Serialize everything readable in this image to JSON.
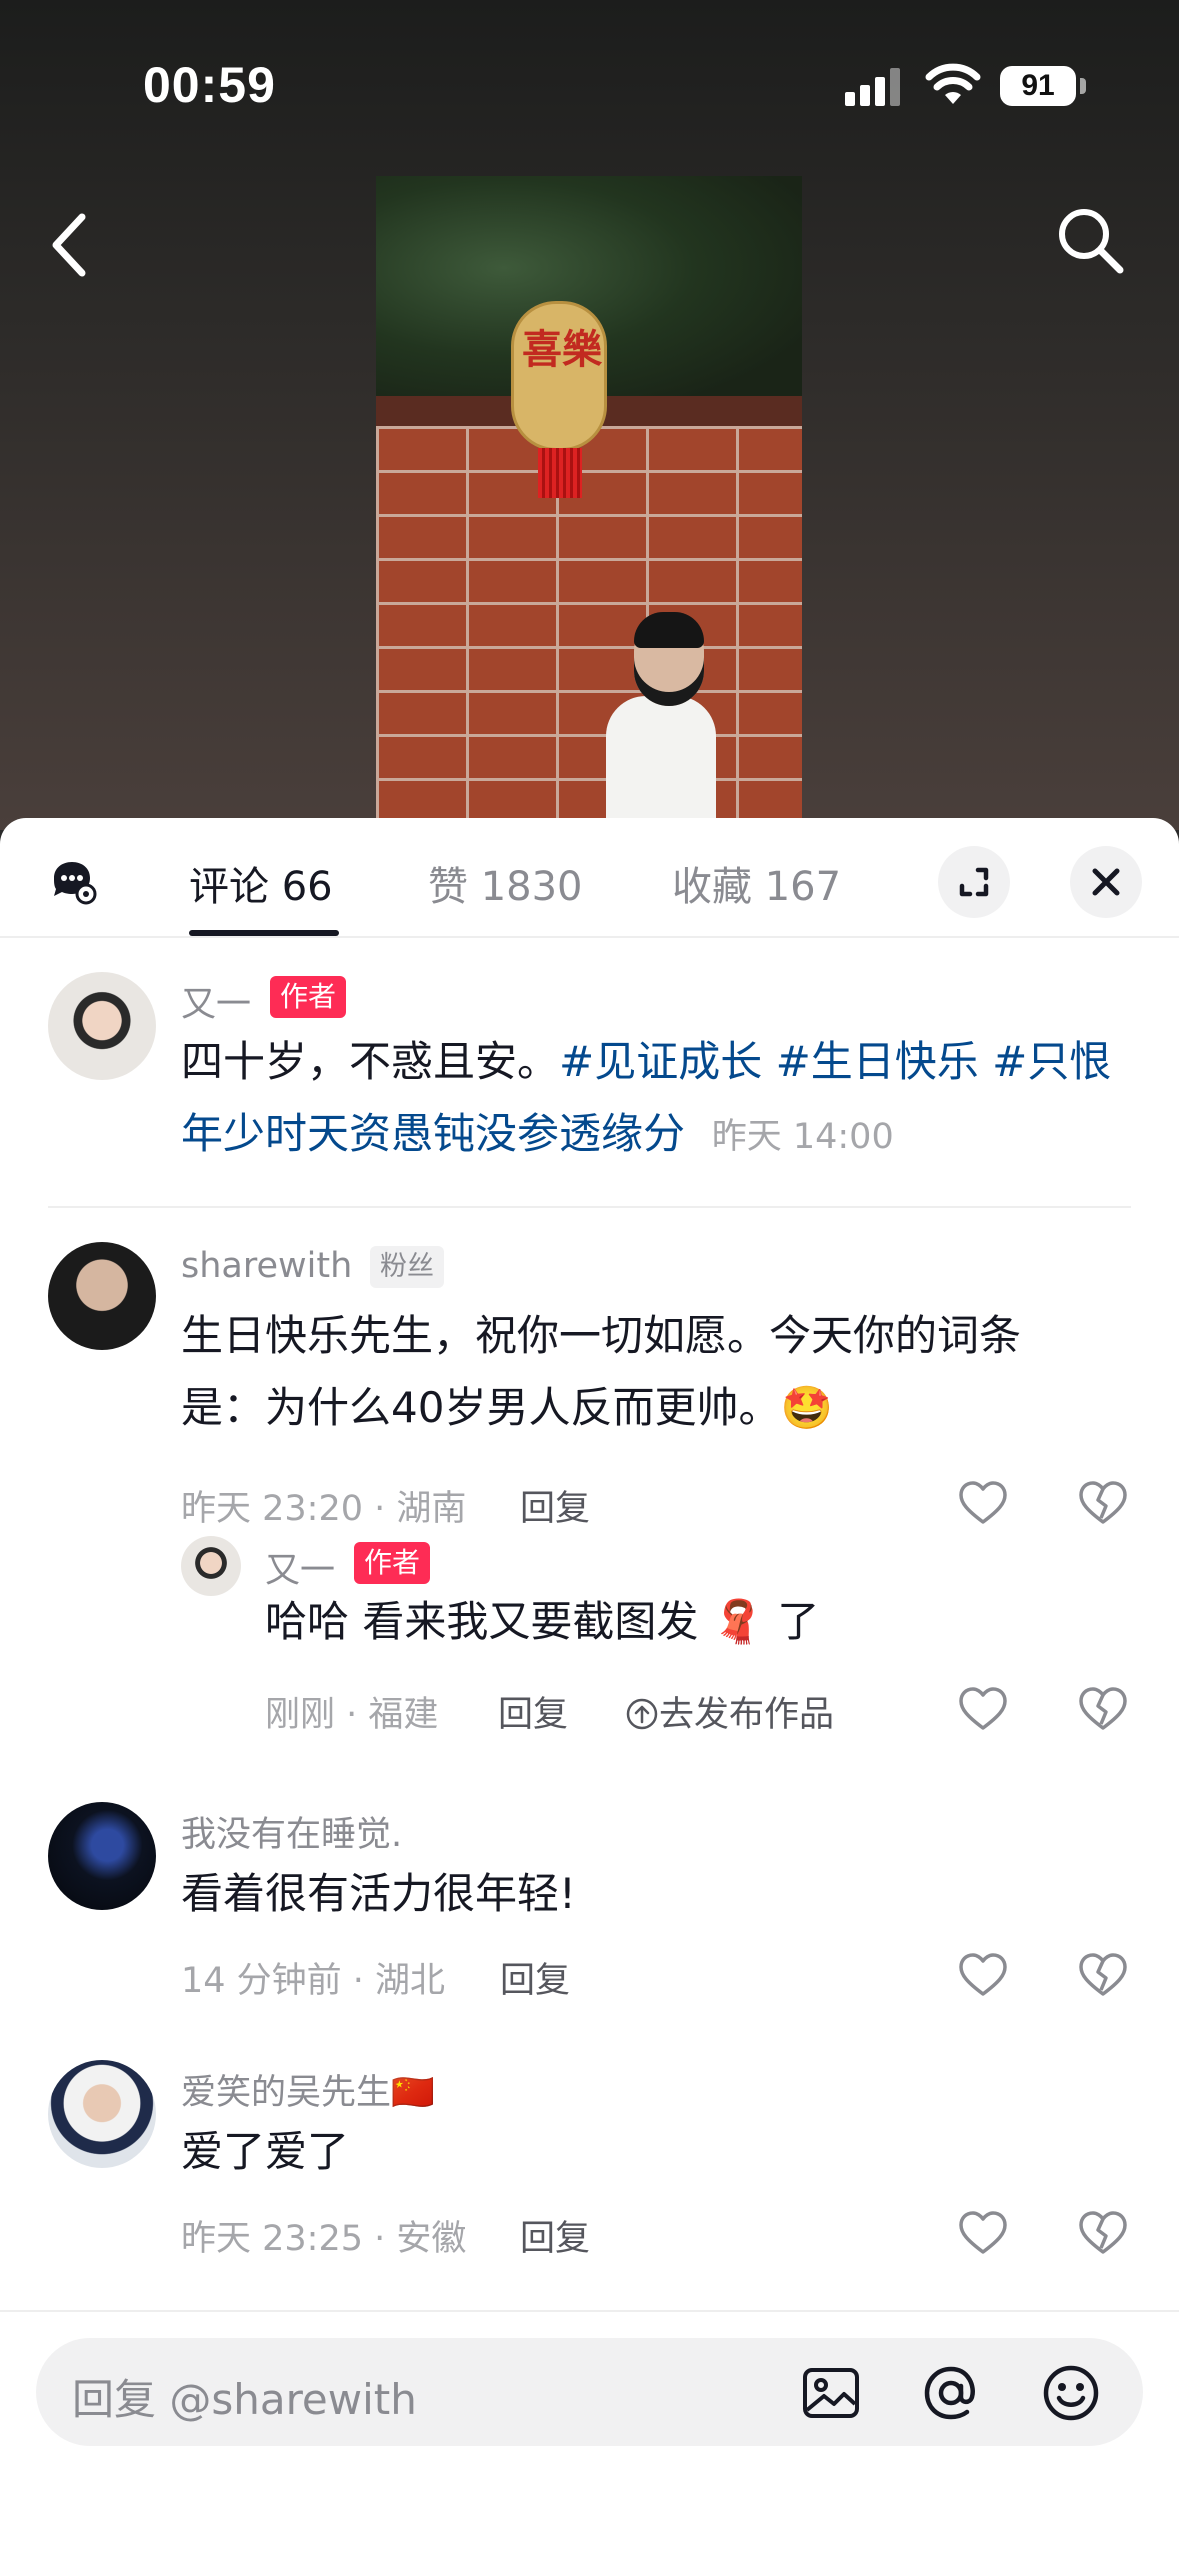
{
  "status": {
    "time": "00:59",
    "battery": "91"
  },
  "video": {
    "lantern_text": "喜樂"
  },
  "tabs": [
    {
      "label": "评论 66"
    },
    {
      "label": "赞 1830"
    },
    {
      "label": "收藏 167"
    }
  ],
  "comments": [
    {
      "user": "又一",
      "badge": "作者",
      "text_plain": "四十岁，不惑且安。",
      "tags": [
        "#见证成长",
        "#生日快乐",
        "#只恨年少时天资愚钝没参透缘分"
      ],
      "time": "昨天 14:00"
    },
    {
      "user": "sharewith",
      "badge": "粉丝",
      "line1": "生日快乐先生，祝你一切如愿。今天你的词条",
      "line2": "是：为什么40岁男人反而更帅。",
      "emoji": "🤩",
      "meta": "昨天 23:20 · 湖南",
      "reply": "回复",
      "sub_reply": {
        "user": "又一",
        "badge": "作者",
        "text_a": "哈哈 看来我又要截图发",
        "emoji": "🧣",
        "text_b": "了",
        "meta": "刚刚 · 福建",
        "reply": "回复",
        "publish": "去发布作品"
      }
    },
    {
      "user": "我没有在睡觉.",
      "text": "看着很有活力很年轻!",
      "meta": "14 分钟前 · 湖北",
      "reply": "回复"
    },
    {
      "user": "爱笑的吴先生",
      "flag": "🇨🇳",
      "text": "爱了爱了",
      "meta": "昨天 23:25 · 安徽",
      "reply": "回复"
    }
  ],
  "input": {
    "placeholder": "回复 @sharewith"
  },
  "colors": {
    "accent": "#fe2c55",
    "tag": "#04498d"
  }
}
